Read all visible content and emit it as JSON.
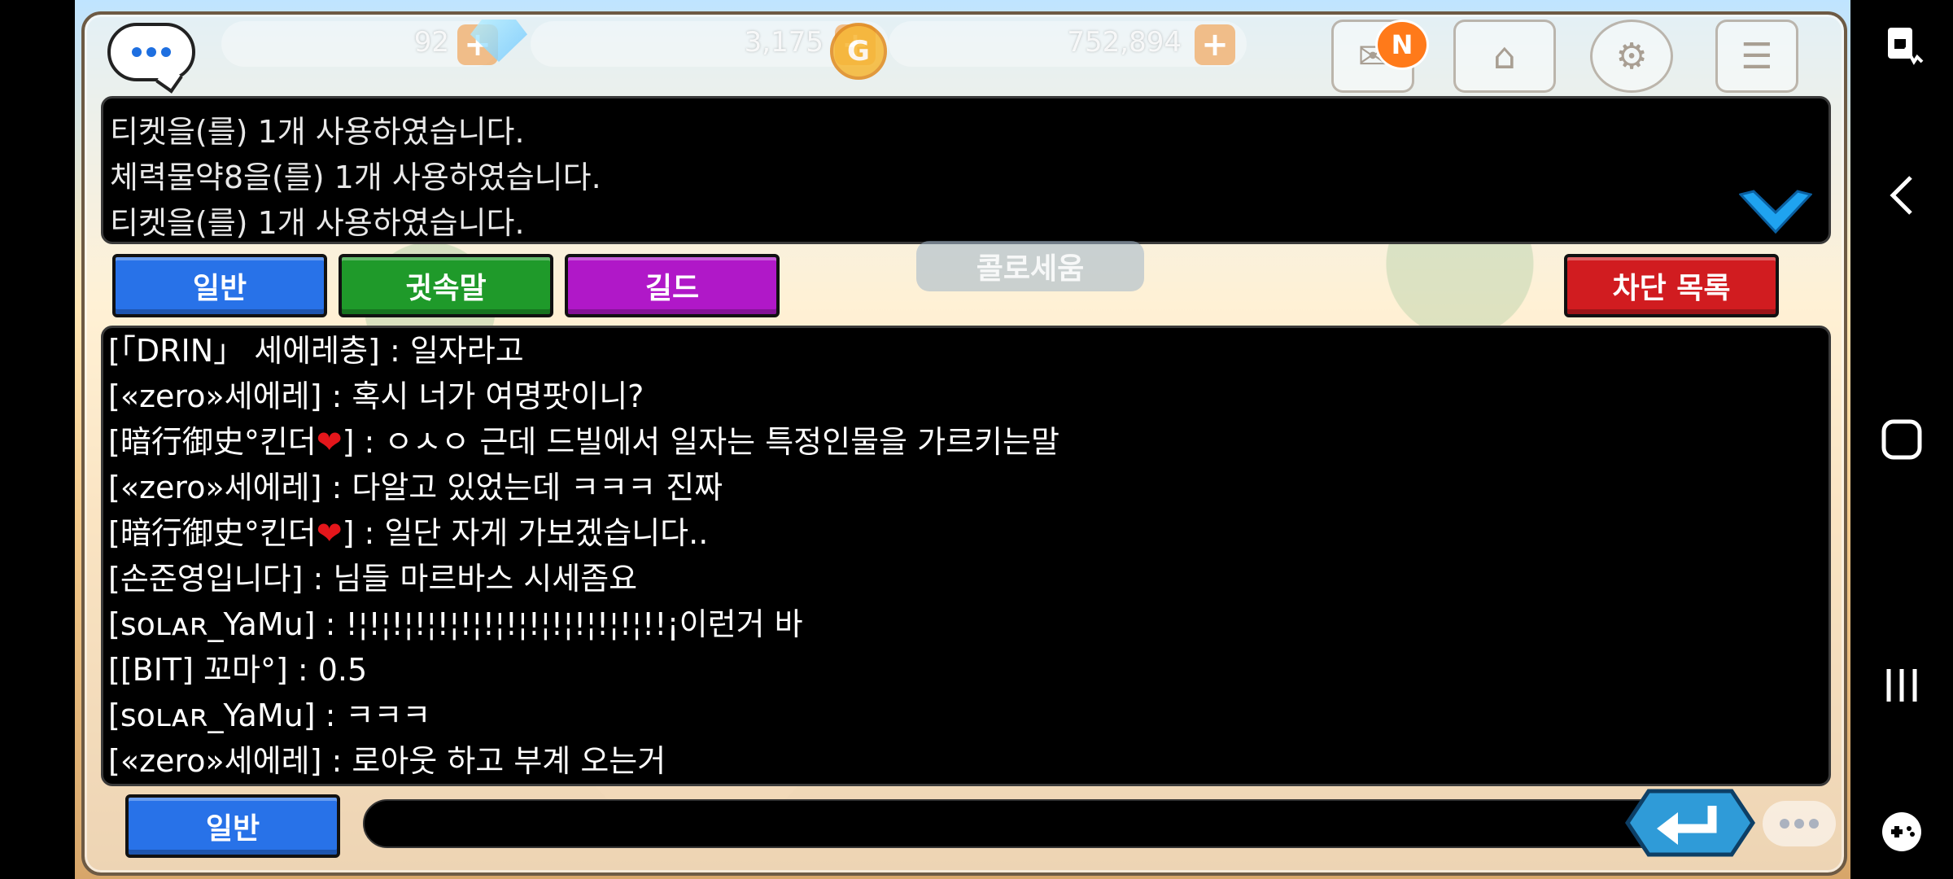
{
  "top_bar": {
    "chat_icon": "chat-bubble-icon",
    "energy_value": "92",
    "gems_value": "3,175",
    "gold_value": "752,894",
    "gold_symbol": "G",
    "mail_badge": "N",
    "icons": [
      "mail-icon",
      "home-icon",
      "settings-icon",
      "menu-icon"
    ]
  },
  "system_log": [
    "티켓을(를) 1개 사용하였습니다.",
    "체력물약8을(를) 1개 사용하였습니다.",
    "티켓을(를) 1개 사용하였습니다."
  ],
  "tabs": {
    "general": "일반",
    "whisper": "귓속말",
    "guild": "길드",
    "block_list": "차단 목록"
  },
  "background_label": "콜로세움",
  "messages": [
    {
      "sender": "[「DRIN」 세에레충]",
      "text": " : 일자라고"
    },
    {
      "sender": "[«zero»세에레]",
      "text": " : 혹시 너가 여명팟이니?"
    },
    {
      "sender": "[暗行御史°킨더",
      "heart": "❤",
      "sender_end": "]",
      "text": " : ㅇㅅㅇ 근데 드빌에서 일자는 특정인물을 가르키는말"
    },
    {
      "sender": "[«zero»세에레]",
      "text": " : 다알고 있었는데 ㅋㅋㅋ 진짜"
    },
    {
      "sender": "[暗行御史°킨더",
      "heart": "❤",
      "sender_end": "]",
      "text": " : 일단 자게 가보겠습니다.."
    },
    {
      "sender": "[손준영입니다]",
      "text": " : 님들 마르바스 시세좀요"
    },
    {
      "sender": "[sᴏʟᴀʀ_YaMu]",
      "text": " : !¦!¦!¦!¦!¦!¦!¦!¦!¦!¦!¦!¦!¦!!¡이런거 바"
    },
    {
      "sender": "[[BIT] 꼬마°]",
      "text": " : 0.5"
    },
    {
      "sender": "[sᴏʟᴀʀ_YaMu]",
      "text": " : ㅋㅋㅋ"
    },
    {
      "sender": "[«zero»세에레]",
      "text": " : 로아웃 하고 부계 오는거"
    }
  ],
  "input_row": {
    "channel_label": "일반",
    "input_value": "",
    "input_placeholder": "",
    "send_icon": "enter-arrow-icon"
  },
  "android_nav": [
    "screenshot-lock-icon",
    "back-icon",
    "home-icon",
    "recents-icon",
    "game-tools-icon"
  ],
  "colors": {
    "general_tab": "#2872e8",
    "whisper_tab": "#1f9a2a",
    "guild_tab": "#b018c8",
    "block_tab": "#d11c20",
    "send_button": "#2f9bd8",
    "heart": "#e4161b"
  }
}
